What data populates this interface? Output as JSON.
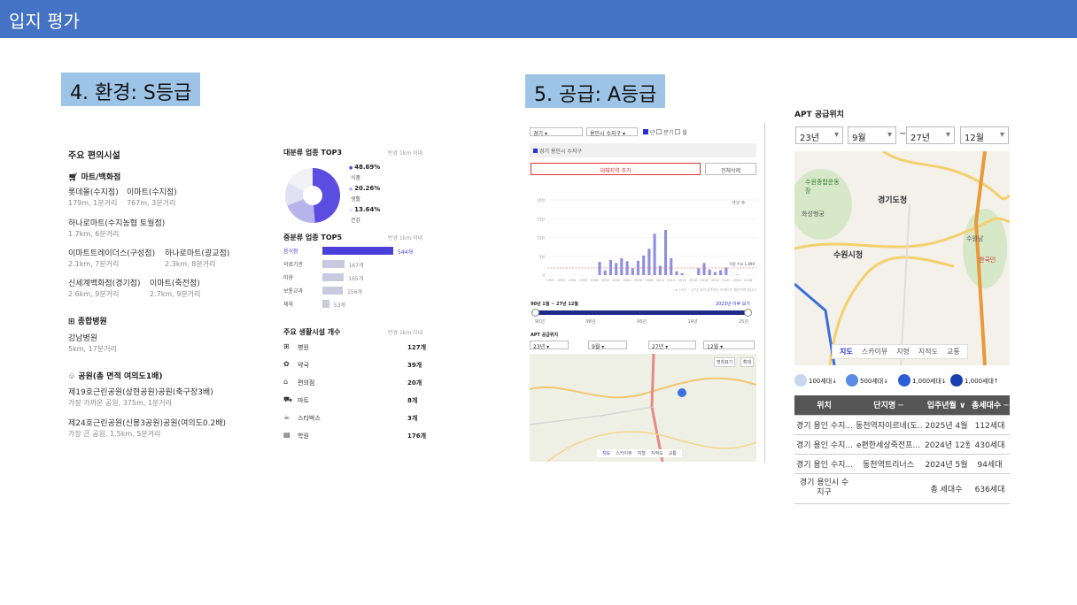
{
  "header": {
    "title": "입지 평가"
  },
  "env_label": "4. 환경: S등급",
  "supply_label": "5. 공급: A등급",
  "env": {
    "title": "주요 편의시설",
    "mart_title": "마트/백화점",
    "marts": [
      {
        "name": "롯데몰(수지점)",
        "dist": "179m, 1분거리"
      },
      {
        "name": "이마트(수지점)",
        "dist": "767m, 3분거리"
      },
      {
        "name": "하나로마트(수지농협 토월점)",
        "dist": "1.7km, 6분거리"
      },
      {
        "name": "이마트트레이더스(구성점)",
        "dist": "2.1km, 7분거리"
      },
      {
        "name": "하나로마트(광교점)",
        "dist": "2.3km, 8분거리"
      },
      {
        "name": "신세계백화점(경기점)",
        "dist": "2.6km, 9분거리"
      },
      {
        "name": "이마트(죽전점)",
        "dist": "2.7km, 9분거리"
      }
    ],
    "hospital_title": "종합병원",
    "hospital": {
      "name": "강남병원",
      "dist": "5km, 17분거리"
    },
    "park_title": "공원(총 면적 여의도1배)",
    "parks": [
      {
        "name": "제19호근린공원(상현공원)공원(축구장3배)",
        "dist": "가장 가까운 공원, 375m, 1분거리"
      },
      {
        "name": "제24호근린공원(신봉3공원)공원(여의도0.2배)",
        "dist": "가장 큰 공원, 1.5km, 5분거리"
      }
    ],
    "top3_title": "대분류 업종 TOP3",
    "radius": "반경 1km 이내",
    "pie": [
      {
        "pct": "48.69%",
        "name": "식품",
        "value": 48.69,
        "color": "#5b4de0"
      },
      {
        "pct": "20.26%",
        "name": "생활",
        "value": 20.26,
        "color": "#b8b3ea"
      },
      {
        "pct": "13.64%",
        "name": "건강",
        "value": 13.64,
        "color": "#e2e0f3"
      }
    ],
    "top5_title": "중분류 업종 TOP5",
    "top5": [
      {
        "name": "음식점",
        "count": "544개",
        "value": 544
      },
      {
        "name": "의료기관",
        "count": "167개",
        "value": 167
      },
      {
        "name": "미용",
        "count": "165개",
        "value": 165
      },
      {
        "name": "보통교과",
        "count": "156개",
        "value": 156
      },
      {
        "name": "체육",
        "count": "53개",
        "value": 53
      }
    ],
    "life_title": "주요 생활시설 개수",
    "life": [
      {
        "icon": "hospital-icon",
        "glyph": "⊞",
        "name": "병원",
        "count": "127개"
      },
      {
        "icon": "pharmacy-icon",
        "glyph": "✿",
        "name": "약국",
        "count": "39개"
      },
      {
        "icon": "store-icon",
        "glyph": "⌂",
        "name": "편의점",
        "count": "20개"
      },
      {
        "icon": "cart-icon",
        "glyph": "⛟",
        "name": "마트",
        "count": "8개"
      },
      {
        "icon": "coffee-icon",
        "glyph": "☕",
        "name": "스타벅스",
        "count": "3개"
      },
      {
        "icon": "book-icon",
        "glyph": "▤",
        "name": "학원",
        "count": "176개"
      }
    ]
  },
  "supply": {
    "region": "경기",
    "district": "용인시 수지구",
    "chk": [
      "년",
      "분기",
      "월"
    ],
    "item": "경기 용인시 수지구",
    "add_btn": "대체지역 추가",
    "del_btn": "전체삭제",
    "chart_unit": "가구 수",
    "yticks": [
      "20천",
      "15천",
      "10천",
      "5천",
      "0"
    ],
    "xticks": [
      "1990",
      "1992",
      "1994",
      "1996",
      "1998",
      "2000",
      "2002",
      "2004",
      "2006",
      "2008",
      "2010",
      "2012",
      "2014",
      "2016",
      "2018",
      "2020",
      "2022",
      "2024",
      "2026"
    ],
    "avg_label": "적정 수요 1,890",
    "note": "※ 23년 ~ 27년 사이 입주하는 아파트는 별산하여 입니다",
    "range_label": "90년 1월 ~ 27년 12월",
    "range_link": "2023년 이후 보기",
    "range_ticks": [
      "90년",
      "98년",
      "06년",
      "14년",
      "25년"
    ],
    "apt_loc": "APT 공급위치",
    "sels": [
      "23년",
      "9월",
      "27년",
      "12월"
    ],
    "map_btns": [
      "명칭표기",
      "확대"
    ],
    "map_tabs": [
      "지도",
      "스카이뷰",
      "지형",
      "지적도",
      "교통"
    ]
  },
  "apt": {
    "title": "APT 공급위치",
    "from_y": "23년",
    "from_m": "9월",
    "tilde": "~",
    "to_y": "27년",
    "to_m": "12월",
    "map_labels": [
      "경기도청",
      "수원시청",
      "수원종합운동장",
      "화성행궁",
      "수원남",
      "한국인"
    ],
    "map_tabs": [
      "지도",
      "스카이뷰",
      "지형",
      "지적도",
      "교통"
    ],
    "legend": [
      "100세대↓",
      "500세대↓",
      "1,000세대↓",
      "1,000세대↑"
    ],
    "headers": [
      "위치",
      "단지명 ─",
      "입주년월 ∨",
      "총세대수 ─"
    ],
    "rows": [
      [
        "경기 용인 수지...",
        "동천역자이르네(도...",
        "2025년 4월",
        "112세대"
      ],
      [
        "경기 용인 수지...",
        "e편한세상죽전프...",
        "2024년 12월",
        "430세대"
      ],
      [
        "경기 용인 수지...",
        "동천역트리너스",
        "2024년 5월",
        "94세대"
      ]
    ],
    "total": [
      "경기 용인시 수지구",
      "",
      "총 세대수",
      "636세대"
    ]
  },
  "chart_data": {
    "type": "bar",
    "ylabel": "가구 수",
    "ylim": [
      0,
      20000
    ],
    "x": [
      1990,
      1991,
      1992,
      1993,
      1994,
      1995,
      1996,
      1997,
      1998,
      1999,
      2000,
      2001,
      2002,
      2003,
      2004,
      2005,
      2006,
      2007,
      2008,
      2009,
      2010,
      2011,
      2012,
      2013,
      2014,
      2015,
      2016,
      2017,
      2018,
      2019,
      2020,
      2021,
      2022,
      2023,
      2024,
      2025,
      2026,
      2027
    ],
    "values": [
      0,
      0,
      0,
      0,
      0,
      0,
      0,
      0,
      0,
      3500,
      1200,
      4000,
      3200,
      4500,
      3700,
      1800,
      3800,
      5200,
      7000,
      11000,
      2500,
      12000,
      4500,
      1000,
      500,
      0,
      0,
      1800,
      3200,
      1500,
      800,
      1300,
      2000,
      0,
      112,
      0,
      0,
      0
    ]
  }
}
